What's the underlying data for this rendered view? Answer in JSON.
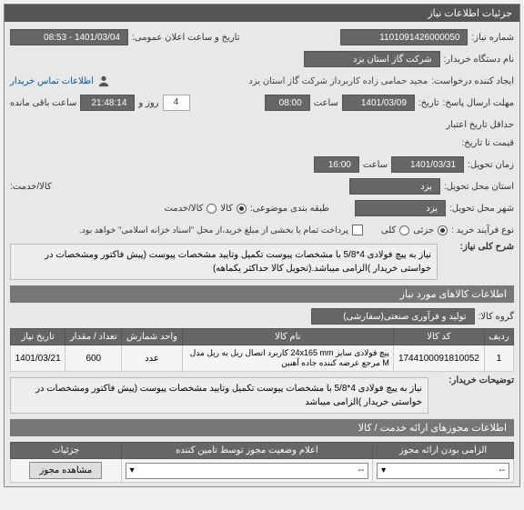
{
  "main_header": "جزئیات اطلاعات نیاز",
  "need_number_label": "شماره نیاز:",
  "need_number": "1101091426000050",
  "public_date_label": "تاریخ و ساعت اعلان عمومی:",
  "public_date": "1401/03/04 - 08:53",
  "buyer_label": "نام دستگاه خریدار:",
  "buyer": "شرکت گاز استان یزد",
  "requester_label": "ایجاد کننده درخواست:",
  "requester": "مجید حمامی زاده کاربرداز شرکت گاز استان یزد",
  "contact_label": "اطلاعات تماس خریدار",
  "send_deadline_label": "مهلت ارسال پاسخ:",
  "send_deadline_date": "1401/03/09",
  "time_label": "ساعت",
  "send_deadline_time": "08:00",
  "day_label": "روز و",
  "day_value": "4",
  "remaining_label": "ساعت باقی مانده",
  "remaining_time": "21:48:14",
  "date_label_generic": "تاریخ:",
  "min_validity_label": "حداقل تاریخ اعتبار",
  "price_to_label": "قیمت تا تاریخ:",
  "delivery_deadline_label": "زمان تحویل:",
  "delivery_date": "1401/03/31",
  "delivery_time": "16:00",
  "delivery_place_label": "استان محل تحویل:",
  "delivery_place": "یزد",
  "delivery_city_label": "شهر محل تحویل:",
  "delivery_city": "یزد",
  "goods_service_label": "کالا/خدمت:",
  "category_label": "طبقه بندی موضوعی:",
  "goods_opt": "کالا",
  "service_opt": "کالا/خدمت",
  "purchase_type_label": "نوع فرآیند خرید :",
  "partial_opt": "جزئی",
  "full_opt": "کلی",
  "payment_note": "پرداخت تمام یا بخشی از مبلغ خرید،از محل \"اسناد خزانه اسلامی\" خواهد بود.",
  "main_desc_label": "شرح کلی نیاز:",
  "main_desc": "نیاز به پیچ فولادی 4*5/8 با مشخصات پیوست تکمیل وتایید مشخصات پیوست (پیش فاکتور ومشخصات در خواستی خریدار )الزامی میباشد.(تحویل کالا حداکثر یکماهه)",
  "items_header": "اطلاعات کالاهای مورد نیاز",
  "goods_group_label": "گروه کالا:",
  "goods_group": "تولید و فرآوری صنعتی(سفارشی)",
  "table": {
    "headers": [
      "ردیف",
      "کد کالا",
      "نام کالا",
      "واحد شمارش",
      "تعداد / مقدار",
      "تاریخ نیاز"
    ],
    "row": {
      "idx": "1",
      "code": "1744100091810052",
      "name": "پیچ فولادی سایز 24x165 mm کاربرد اتصال ریل به ریل مدل M مرجع عرضه کننده جاده آهنین",
      "unit": "عدد",
      "qty": "600",
      "date": "1401/03/21"
    }
  },
  "buyer_notes_label": "توضیحات خریدار:",
  "buyer_notes": "نیاز به پیچ فولادی 4*5/8 با مشخصات پیوست تکمیل وتایید مشخصات پیوست (پیش فاکتور ومشخصات در خواستی خریدار )الزامی میباشد",
  "permits_header": "اطلاعات مجوزهای ارائه خدمت / کالا",
  "permit_required_label": "الزامی بودن ارائه مجوز",
  "supplier_status_label": "اعلام وضعیت مجوز توسط تامین کننده",
  "details_label": "جزئیات",
  "select_placeholder": "--",
  "view_permit_btn": "مشاهده مجوز"
}
